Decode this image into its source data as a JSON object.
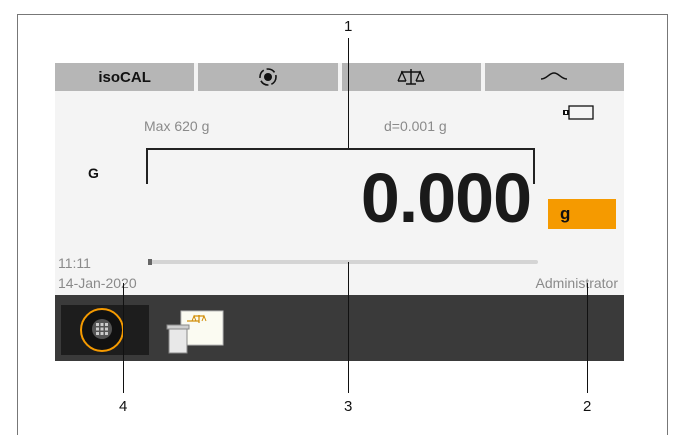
{
  "callouts": [
    "1",
    "2",
    "3",
    "4"
  ],
  "tabs": [
    {
      "label": "isoCAL",
      "icon": ""
    },
    {
      "label": "",
      "icon": "level-target-icon"
    },
    {
      "label": "",
      "icon": "balance-scale-icon"
    },
    {
      "label": "",
      "icon": "wave-signal-icon"
    }
  ],
  "spec": {
    "max": "Max 620 g",
    "d": "d=0.001 g"
  },
  "mode_label": "G",
  "reading": "0.000",
  "unit": "g",
  "progress": 0.01,
  "time": "11:11",
  "date": "14-Jan-2020",
  "user": "Administrator",
  "colors": {
    "accent": "#f59a00",
    "tab_bg": "#b6b6b6",
    "bottom_bar": "#3a3a3a"
  }
}
